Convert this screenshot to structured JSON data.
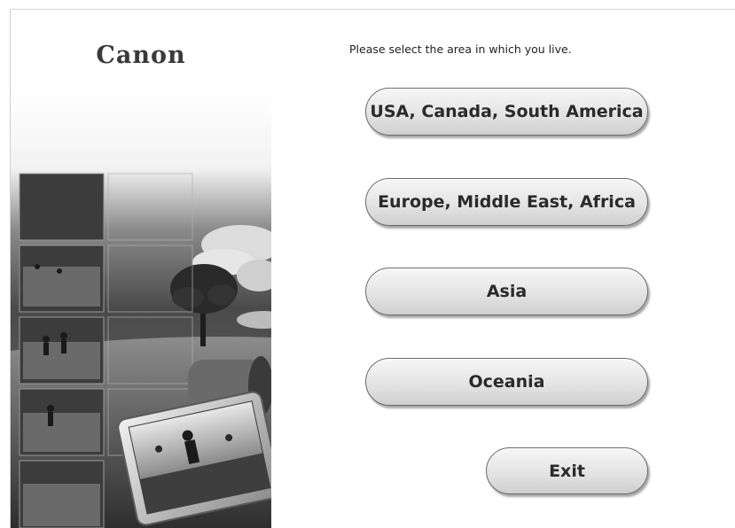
{
  "brand": {
    "logo_text": "Canon"
  },
  "prompt_text": "Please select the area in which you live.",
  "regions": [
    {
      "label": "USA, Canada, South America"
    },
    {
      "label": "Europe, Middle East, Africa"
    },
    {
      "label": "Asia"
    },
    {
      "label": "Oceania"
    }
  ],
  "exit_label": "Exit"
}
